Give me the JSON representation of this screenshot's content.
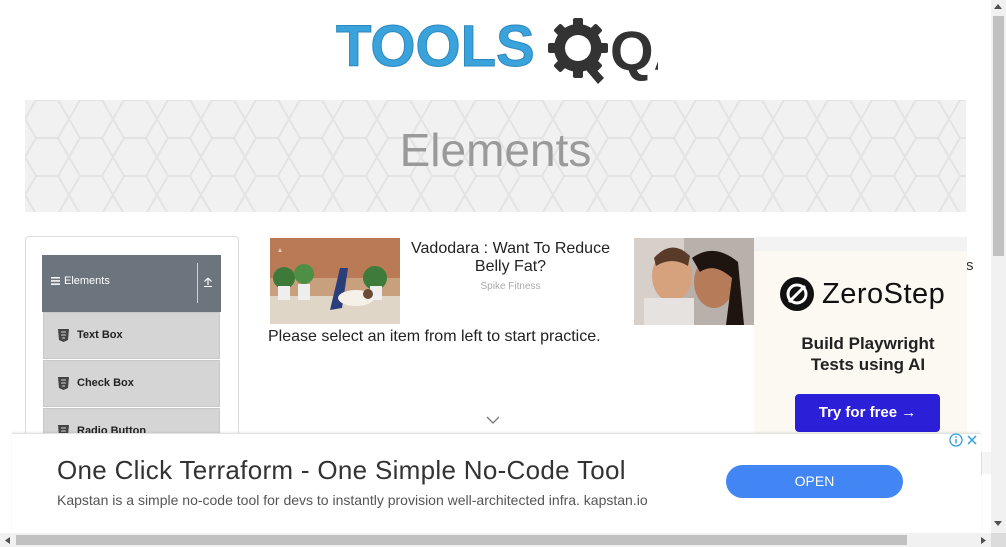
{
  "logo": {
    "text_left": "TOOLS",
    "text_right": "QA"
  },
  "banner": {
    "title": "Elements"
  },
  "sidebar": {
    "group_label": "Elements",
    "items": [
      {
        "label": "Text Box"
      },
      {
        "label": "Check Box"
      },
      {
        "label": "Radio Button"
      }
    ]
  },
  "ads": {
    "card1": {
      "title": "Vadodara : Want To Reduce Belly Fat?",
      "sponsor": "Spike Fitness"
    },
    "card2": {
      "partial_text": "s"
    },
    "zerostep": {
      "name": "ZeroStep",
      "tagline": "Build Playwright Tests using AI",
      "button": "Try for free →"
    },
    "bottom": {
      "headline": "One Click Terraform - One Simple No-Code Tool",
      "description": "Kapstan is a simple no-code tool for devs to instantly provision well-architected infra. kapstan.io",
      "button": "OPEN"
    }
  },
  "main": {
    "instruction": "Please select an item from left to start practice."
  },
  "colors": {
    "brand_blue": "#3ba3dc",
    "brand_dark": "#333333",
    "sidebar_header": "#6c757d",
    "cta_blue": "#4285f4",
    "zerostep_button": "#2b1fd8"
  },
  "icons": [
    "menu-icon",
    "collapse-icon",
    "html5-icon",
    "chevron-down-icon",
    "ad-info-icon",
    "ad-close-icon"
  ]
}
